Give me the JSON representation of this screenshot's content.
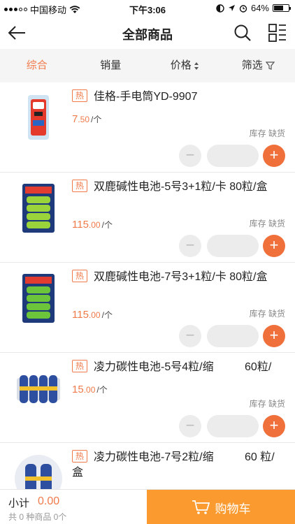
{
  "status_bar": {
    "carrier": "中国移动",
    "time": "下午3:06",
    "battery": "64%",
    "battery_level": 0.64
  },
  "navbar": {
    "title": "全部商品"
  },
  "tabs": [
    {
      "label": "综合",
      "active": true
    },
    {
      "label": "销量",
      "active": false
    },
    {
      "label": "价格",
      "active": false
    },
    {
      "label": "筛选",
      "active": false
    }
  ],
  "products": [
    {
      "tag": "热",
      "name": "佳格-手电筒YD-9907",
      "price_int": "7",
      "price_dec": ".50",
      "unit": "/个",
      "stock_label": "库存",
      "stock_status": "缺货"
    },
    {
      "tag": "热",
      "name": "双鹿碱性电池-5号3+1粒/卡 80粒/盒",
      "price_int": "115",
      "price_dec": ".00",
      "unit": "/个",
      "stock_label": "库存",
      "stock_status": "缺货"
    },
    {
      "tag": "热",
      "name": "双鹿碱性电池-7号3+1粒/卡 80粒/盒",
      "price_int": "115",
      "price_dec": ".00",
      "unit": "/个",
      "stock_label": "库存",
      "stock_status": "缺货"
    },
    {
      "tag": "热",
      "name": "凌力碳性电池-5号4粒/缩          60粒/",
      "price_int": "15",
      "price_dec": ".00",
      "unit": "/个",
      "stock_label": "库存",
      "stock_status": "缺货"
    },
    {
      "tag": "热",
      "name": "凌力碳性电池-7号2粒/缩          60 粒/盒",
      "price_int": "",
      "price_dec": "",
      "unit": "",
      "stock_label": "",
      "stock_status": ""
    }
  ],
  "stepper": {
    "minus": "−",
    "plus": "+"
  },
  "bottom": {
    "subtotal_label": "小计",
    "subtotal_value": "0.00",
    "summary": "共 0 种商品 0个",
    "cart_label": "购物车"
  }
}
